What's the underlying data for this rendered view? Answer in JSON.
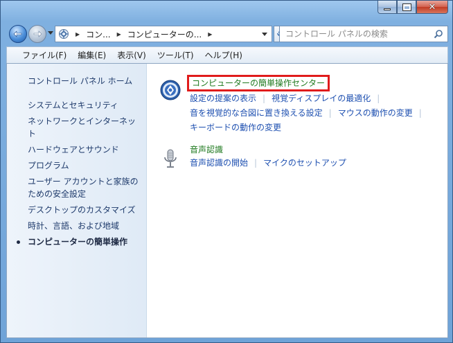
{
  "address": {
    "crumbs": [
      "コン...",
      "コンピューターの..."
    ]
  },
  "search": {
    "placeholder": "コントロール パネルの検索"
  },
  "menu": [
    "ファイル(F)",
    "編集(E)",
    "表示(V)",
    "ツール(T)",
    "ヘルプ(H)"
  ],
  "sidebar": {
    "home": "コントロール パネル ホーム",
    "items": [
      "システムとセキュリティ",
      "ネットワークとインターネット",
      "ハードウェアとサウンド",
      "プログラム",
      "ユーザー アカウントと家族のための安全設定",
      "デスクトップのカスタマイズ",
      "時計、言語、および地域"
    ],
    "current": "コンピューターの簡単操作"
  },
  "sections": {
    "ease": {
      "title": "コンピューターの簡単操作センター",
      "links_row1": [
        "設定の提案の表示",
        "視覚ディスプレイの最適化"
      ],
      "links_row2": [
        "音を視覚的な合図に置き換える設定",
        "マウスの動作の変更"
      ],
      "links_row3": [
        "キーボードの動作の変更"
      ]
    },
    "speech": {
      "title": "音声認識",
      "links_row1": [
        "音声認識の開始",
        "マイクのセットアップ"
      ]
    }
  },
  "colors": {
    "highlight_border": "#e01b1b",
    "link": "#1d4fb0",
    "section_title": "#1f7a1f"
  }
}
